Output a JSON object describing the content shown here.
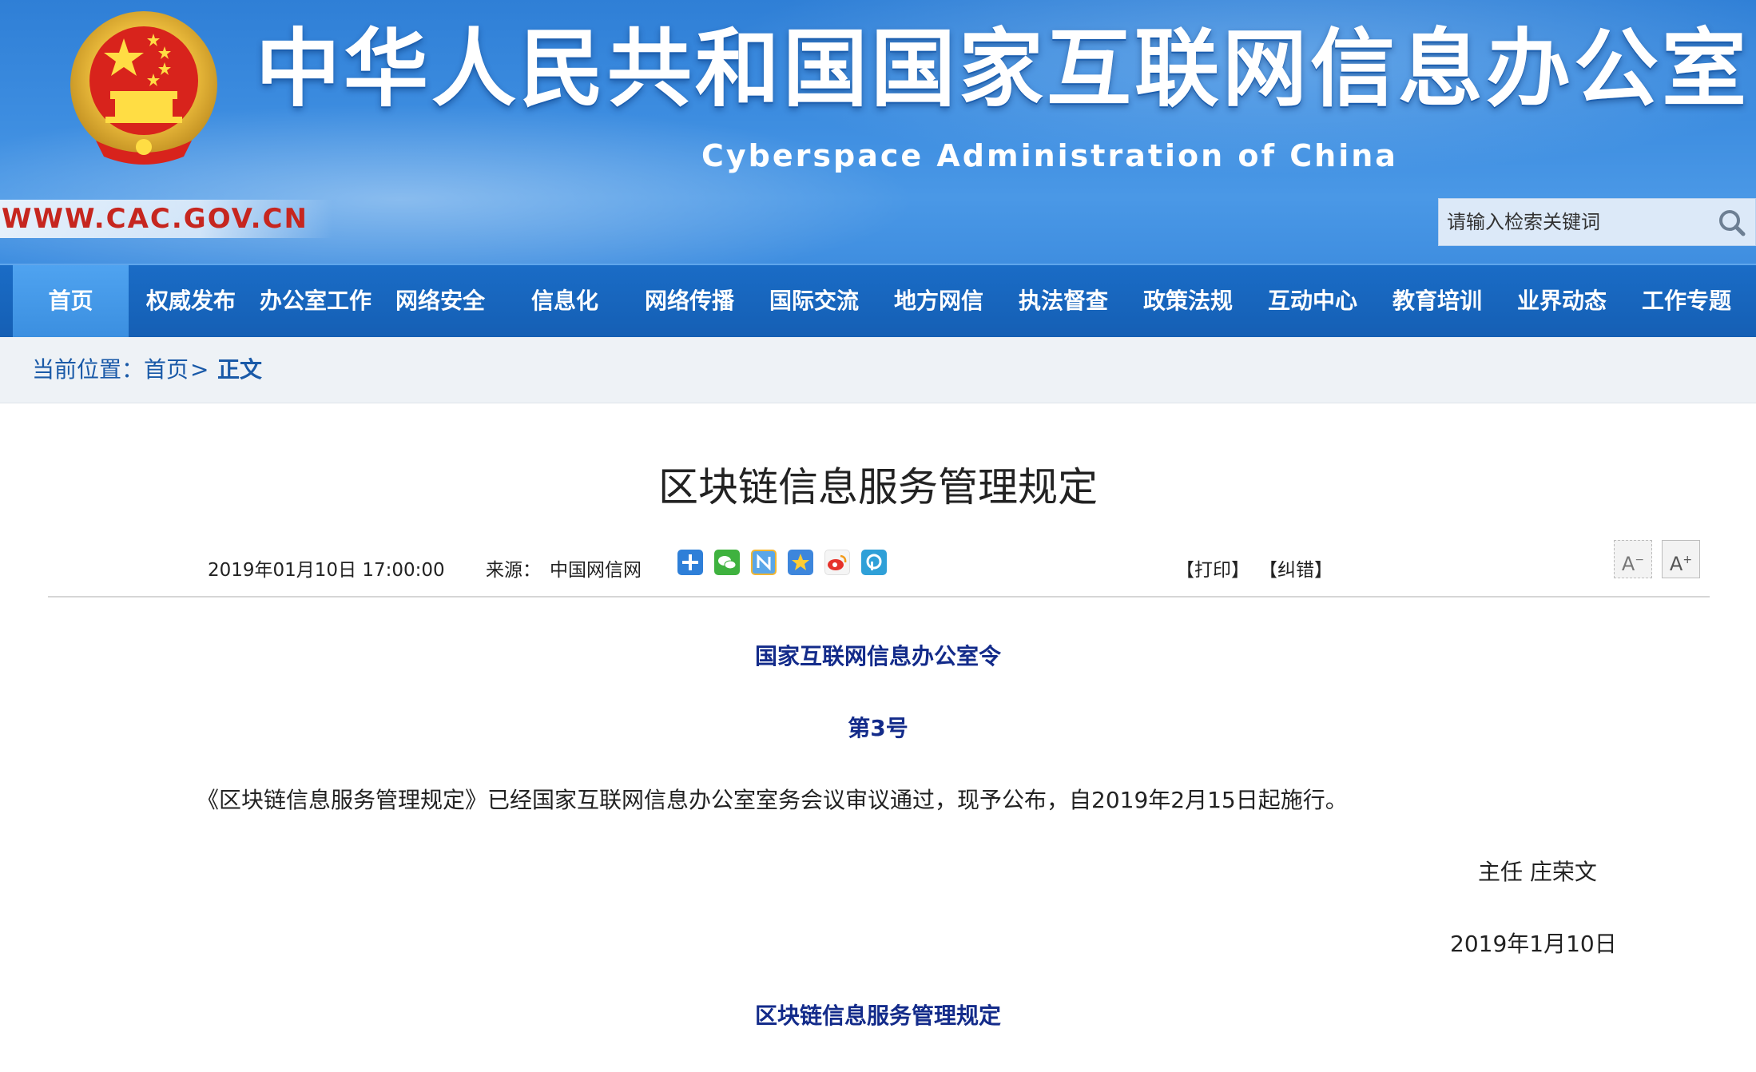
{
  "header": {
    "site_title": "中华人民共和国国家互联网信息办公室",
    "site_subtitle": "Cyberspace Administration of China",
    "site_url": "WWW.CAC.GOV.CN",
    "search_placeholder": "请输入检索关键词"
  },
  "nav": {
    "items": [
      {
        "label": "首页",
        "active": true
      },
      {
        "label": "权威发布"
      },
      {
        "label": "办公室工作"
      },
      {
        "label": "网络安全"
      },
      {
        "label": "信息化"
      },
      {
        "label": "网络传播"
      },
      {
        "label": "国际交流"
      },
      {
        "label": "地方网信"
      },
      {
        "label": "执法督查"
      },
      {
        "label": "政策法规"
      },
      {
        "label": "互动中心"
      },
      {
        "label": "教育培训"
      },
      {
        "label": "业界动态"
      },
      {
        "label": "工作专题"
      }
    ]
  },
  "breadcrumb": {
    "prefix": "当前位置：",
    "home": "首页",
    "separator": " > ",
    "current": "正文"
  },
  "article": {
    "title": "区块链信息服务管理规定",
    "date": "2019年01月10日 17:00:00",
    "source_label": "来源：",
    "source": "中国网信网",
    "print_link": "【打印】",
    "error_link": "【纠错】",
    "font_smaller": "A",
    "font_larger": "A",
    "order_title": "国家互联网信息办公室令",
    "order_number": "第3号",
    "body_text": "《区块链信息服务管理规定》已经国家互联网信息办公室室务会议审议通过，现予公布，自2019年2月15日起施行。",
    "signature": "主任  庄荣文",
    "sign_date": "2019年1月10日",
    "subheading": "区块链信息服务管理规定"
  },
  "colors": {
    "header_blue": "#3d8de0",
    "nav_blue": "#155fb4",
    "nav_active": "#3b8fe0",
    "url_red": "#c6261f",
    "heading_navy": "#132b8a",
    "breadcrumb_blue": "#1a5aa8"
  },
  "share_icons": [
    "add-share-icon",
    "wechat-icon",
    "newsfeed-icon",
    "qzone-icon",
    "weibo-icon",
    "other-share-icon"
  ]
}
